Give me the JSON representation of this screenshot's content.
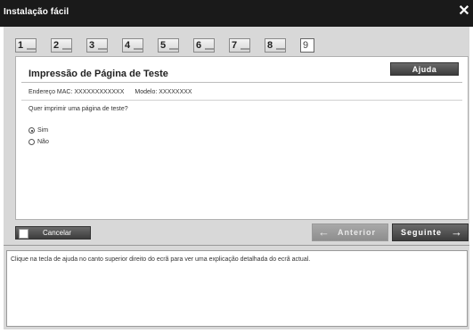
{
  "window": {
    "title": "Instalação fácil",
    "close_icon": "close-icon"
  },
  "steps": [
    {
      "label": "1",
      "state": "done"
    },
    {
      "label": "2",
      "state": "done"
    },
    {
      "label": "3",
      "state": "done"
    },
    {
      "label": "4",
      "state": "done"
    },
    {
      "label": "5",
      "state": "done"
    },
    {
      "label": "6",
      "state": "done"
    },
    {
      "label": "7",
      "state": "done"
    },
    {
      "label": "8",
      "state": "done"
    },
    {
      "label": "9",
      "state": "current"
    }
  ],
  "panel": {
    "title": "Impressão de Página de Teste",
    "help_label": "Ajuda",
    "mac_label": "Endereço MAC: XXXXXXXXXXXX",
    "model_label": "Modelo: XXXXXXXX",
    "question": "Quer imprimir uma página de teste?",
    "options": [
      {
        "label": "Sim",
        "selected": true
      },
      {
        "label": "Não",
        "selected": false
      }
    ]
  },
  "footer": {
    "cancel_label": "Cancelar",
    "prev_label": "Anterior",
    "next_label": "Seguinte",
    "prev_icon": "arrow-left-icon",
    "next_icon": "arrow-right-icon"
  },
  "info": {
    "text": "Clique na tecla de ajuda no canto superior direito do ecrã para ver uma explicação detalhada do ecrã actual."
  }
}
